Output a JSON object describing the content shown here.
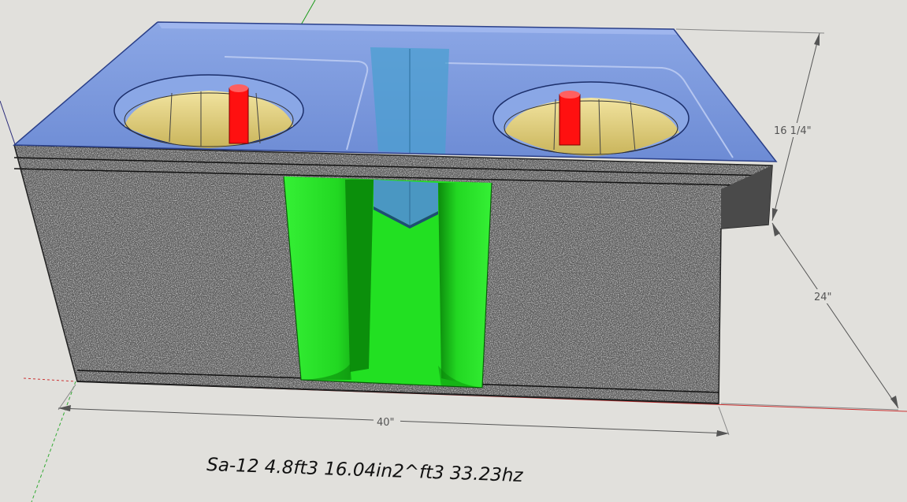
{
  "dimensions": {
    "width_label": "40\"",
    "depth_label": "24\"",
    "height_label": "16 1/4\""
  },
  "caption": "Sa-12 4.8ft3 16.04in2^ft3 33.23hz",
  "colors": {
    "background": "#e1e0dc",
    "top_glass": "#6f8fd8",
    "carpet": "#5a5a5a",
    "port_green": "#22e022",
    "port_green_dark": "#0b8f0b",
    "woofer_cone": "#e3d27a",
    "red_marker": "#ff1010",
    "dimension_line": "#555555"
  }
}
